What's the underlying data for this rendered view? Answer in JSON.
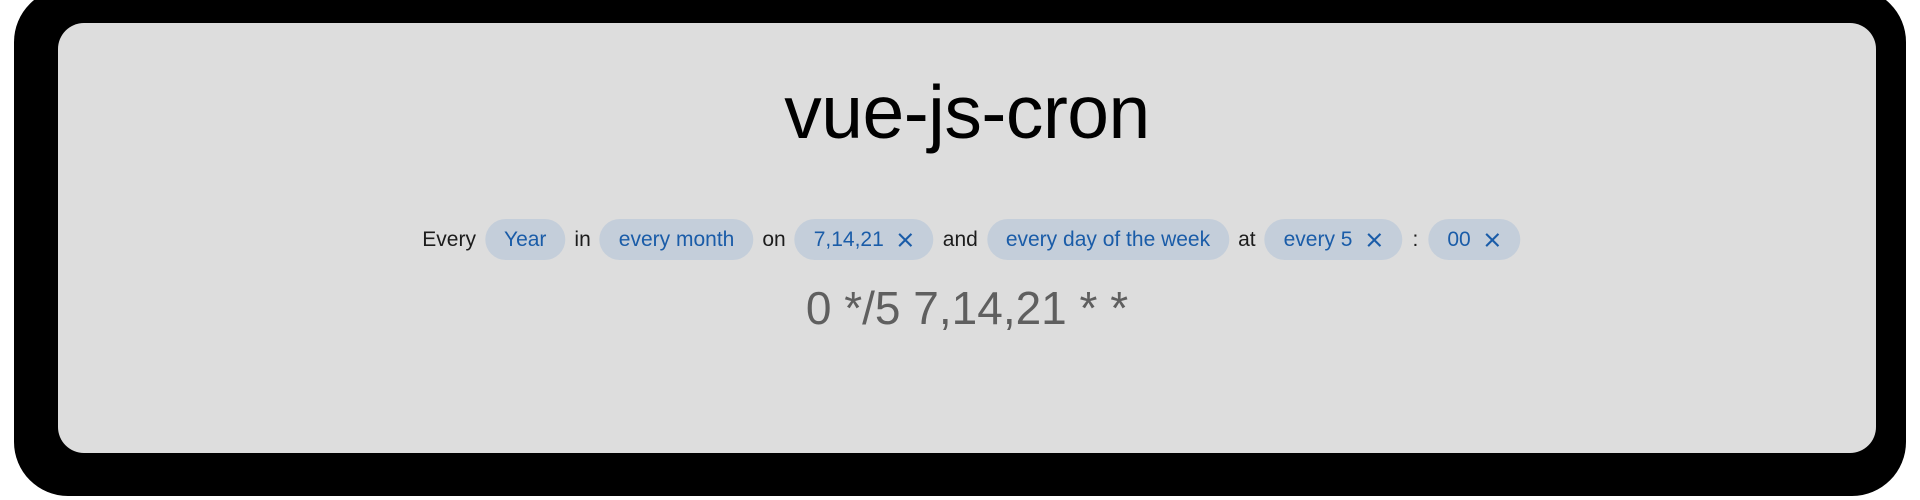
{
  "app": {
    "title": "vue-js-cron"
  },
  "colors": {
    "frame": "#000000",
    "panel_bg": "#dddddd",
    "pill_bg": "#c4ceda",
    "pill_text": "#1a5ca8",
    "conjunction_text": "#1c1c1c",
    "expression_text": "#5f5f5f"
  },
  "cron_editor": {
    "segments": [
      {
        "kind": "text",
        "label": "Every"
      },
      {
        "kind": "pill",
        "name": "period",
        "label": "Year",
        "clearable": false
      },
      {
        "kind": "text",
        "label": "in"
      },
      {
        "kind": "pill",
        "name": "month",
        "label": "every month",
        "clearable": false
      },
      {
        "kind": "text",
        "label": "on"
      },
      {
        "kind": "pill",
        "name": "day-of-month",
        "label": "7,14,21",
        "clearable": true
      },
      {
        "kind": "text",
        "label": "and"
      },
      {
        "kind": "pill",
        "name": "day-of-week",
        "label": "every day of the week",
        "clearable": false
      },
      {
        "kind": "text",
        "label": "at"
      },
      {
        "kind": "pill",
        "name": "hour",
        "label": "every 5",
        "clearable": true
      },
      {
        "kind": "text",
        "label": ":"
      },
      {
        "kind": "pill",
        "name": "minute",
        "label": "00",
        "clearable": true
      }
    ],
    "clear_icon": "close-icon"
  },
  "expression": {
    "value": "0 */5 7,14,21 * *"
  }
}
